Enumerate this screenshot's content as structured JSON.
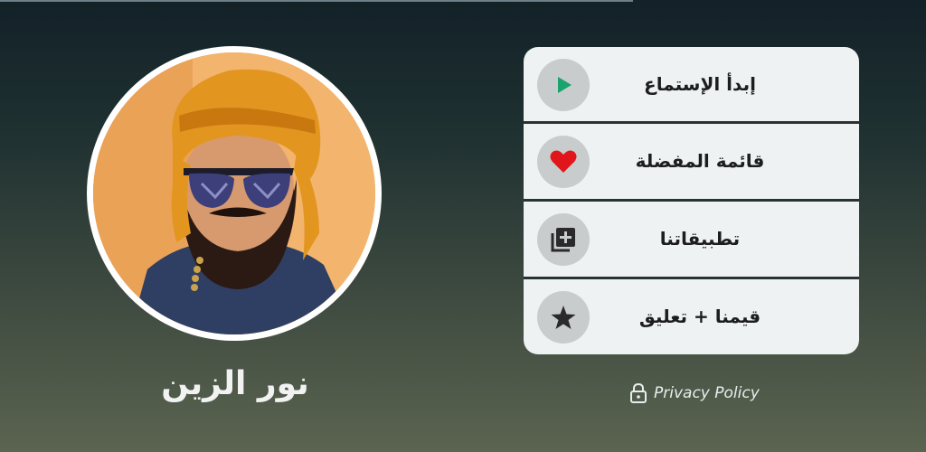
{
  "artist": {
    "name": "نور الزين"
  },
  "menu": {
    "items": [
      {
        "label": "إبدأ الإستماع",
        "icon": "play-icon",
        "icon_color": "#1aa36f"
      },
      {
        "label": "قائمة المفضلة",
        "icon": "heart-icon",
        "icon_color": "#e0161b"
      },
      {
        "label": "تطبيقاتنا",
        "icon": "add-to-library-icon",
        "icon_color": "#2a2a2a"
      },
      {
        "label": "قيمنا + تعليق",
        "icon": "star-icon",
        "icon_color": "#2a2a2a"
      }
    ]
  },
  "privacy": {
    "label": "Privacy Policy",
    "icon": "lock-icon"
  },
  "colors": {
    "menu_background": "#eef2f3",
    "icon_circle": "#c9cccd",
    "divider": "#2a3334"
  }
}
